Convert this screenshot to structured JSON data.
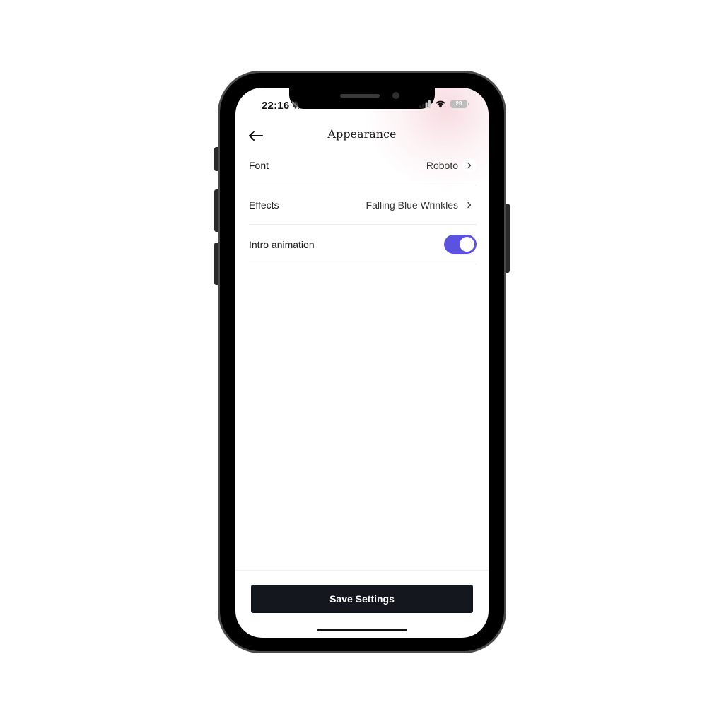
{
  "status_bar": {
    "time": "22:16",
    "battery_level": "28",
    "icons": [
      "bell-muted-icon",
      "signal-icon",
      "wifi-icon",
      "battery-icon"
    ]
  },
  "header": {
    "title": "Appearance",
    "back_icon": "arrow-left-icon"
  },
  "settings": {
    "font": {
      "label": "Font",
      "value": "Roboto"
    },
    "effects": {
      "label": "Effects",
      "value": "Falling Blue Wrinkles"
    },
    "intro_animation": {
      "label": "Intro animation",
      "enabled": true
    }
  },
  "footer": {
    "save_label": "Save Settings"
  },
  "colors": {
    "accent": "#5b53e0",
    "button_bg": "#15171f",
    "glow": "#f6d6dc"
  }
}
